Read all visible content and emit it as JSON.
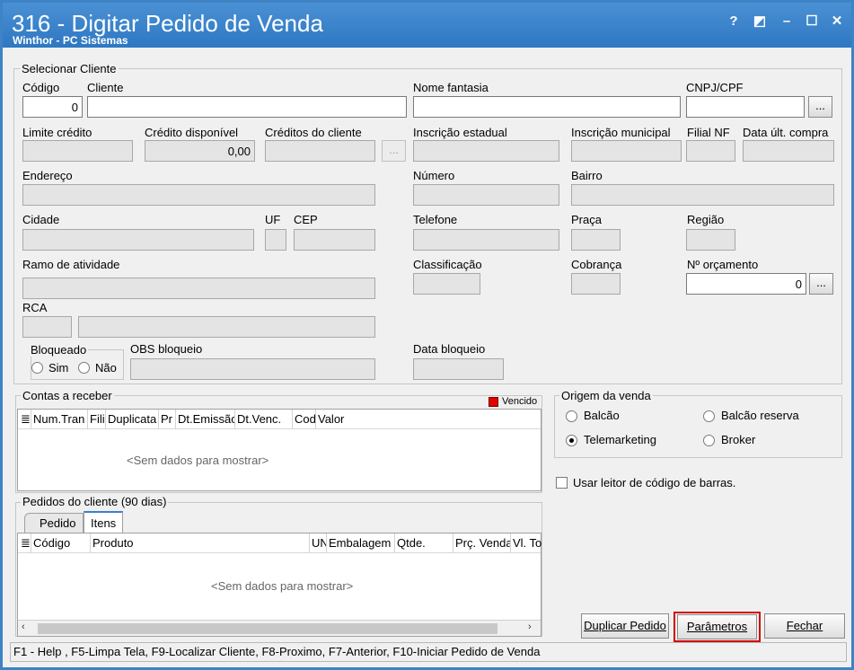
{
  "window": {
    "title": "316 - Digitar Pedido de Venda",
    "subtitle": "Winthor - PC Sistemas",
    "help_icon": "?",
    "restore_icon": "◩",
    "minimize_icon": "–",
    "maximize_icon": "☐",
    "close_icon": "✕"
  },
  "cliente": {
    "group_label": "Selecionar Cliente",
    "codigo_label": "Código",
    "codigo_value": "0",
    "cliente_label": "Cliente",
    "nome_fantasia_label": "Nome fantasia",
    "cnpj_label": "CNPJ/CPF",
    "limite_label": "Limite crédito",
    "credito_disp_label": "Crédito disponível",
    "credito_disp_value": "0,00",
    "creditos_cliente_label": "Créditos do cliente",
    "insc_estadual_label": "Inscrição estadual",
    "insc_municipal_label": "Inscrição municipal",
    "filial_nf_label": "Filial NF",
    "data_ult_compra_label": "Data últ. compra",
    "endereco_label": "Endereço",
    "numero_label": "Número",
    "bairro_label": "Bairro",
    "cidade_label": "Cidade",
    "uf_label": "UF",
    "cep_label": "CEP",
    "telefone_label": "Telefone",
    "praca_label": "Praça",
    "regiao_label": "Região",
    "ramo_label": "Ramo de atividade",
    "classificacao_label": "Classificação",
    "cobranca_label": "Cobrança",
    "orcamento_label": "Nº orçamento",
    "orcamento_value": "0",
    "rca_label": "RCA",
    "bloqueado_label": "Bloqueado",
    "sim_label": "Sim",
    "nao_label": "Não",
    "obs_bloqueio_label": "OBS bloqueio",
    "data_bloqueio_label": "Data bloqueio",
    "dots": "..."
  },
  "contas": {
    "group_label": "Contas a receber",
    "legend_label": "Vencido",
    "legend_color": "#e00000",
    "columns": [
      "Num.Tran",
      "Fili",
      "Duplicata",
      "Pr",
      "Dt.Emissão",
      "Dt.Venc.",
      "Cod",
      "Valor"
    ],
    "empty_text": "<Sem dados para mostrar>"
  },
  "origem": {
    "group_label": "Origem da venda",
    "options": [
      "Balcão",
      "Balcão reserva",
      "Telemarketing",
      "Broker"
    ],
    "selected": "Telemarketing"
  },
  "leitor_label": "Usar leitor de código de barras.",
  "pedidos": {
    "group_label": "Pedidos do cliente (90 dias)",
    "tabs": [
      "Pedido",
      "Itens"
    ],
    "active_tab": "Itens",
    "columns": [
      "Código",
      "Produto",
      "UN",
      "Embalagem",
      "Qtde.",
      "Prç. Venda",
      "Vl. Total"
    ],
    "empty_text": "<Sem dados para mostrar>"
  },
  "buttons": {
    "duplicar": "Duplicar Pedido",
    "parametros": "Parâmetros",
    "fechar": "Fechar",
    "highlight_color": "#d00000"
  },
  "status_bar": "F1 - Help , F5-Limpa Tela, F9-Localizar Cliente, F8-Proximo, F7-Anterior, F10-Iniciar Pedido de Venda"
}
